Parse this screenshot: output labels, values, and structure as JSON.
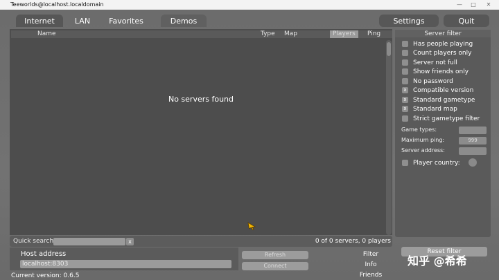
{
  "window": {
    "title": "Teeworlds@localhost.localdomain",
    "controls": [
      "—",
      "□",
      "✕"
    ]
  },
  "tabs": {
    "internet": "Internet",
    "lan": "LAN",
    "favorites": "Favorites",
    "demos": "Demos",
    "settings": "Settings",
    "quit": "Quit"
  },
  "columns": {
    "name": "Name",
    "type": "Type",
    "map": "Map",
    "players": "Players",
    "ping": "Ping"
  },
  "server_list": {
    "empty_message": "No servers found"
  },
  "quick_search": {
    "label": "Quick search:",
    "value": "",
    "clear": "x",
    "count": "0 of 0 servers, 0 players"
  },
  "filter": {
    "title": "Server filter",
    "options": [
      {
        "label": "Has people playing",
        "checked": false
      },
      {
        "label": "Count players only",
        "checked": false
      },
      {
        "label": "Server not full",
        "checked": false
      },
      {
        "label": "Show friends only",
        "checked": false
      },
      {
        "label": "No password",
        "checked": false
      },
      {
        "label": "Compatible version",
        "checked": true
      },
      {
        "label": "Standard gametype",
        "checked": true
      },
      {
        "label": "Standard map",
        "checked": true
      },
      {
        "label": "Strict gametype filter",
        "checked": false
      }
    ],
    "game_types_label": "Game types:",
    "game_types_value": "",
    "max_ping_label": "Maximum ping:",
    "max_ping_value": "999",
    "server_address_label": "Server address:",
    "server_address_value": "",
    "player_country_label": "Player country:",
    "reset_label": "Reset filter"
  },
  "host": {
    "label": "Host address",
    "value": "localhost:8303",
    "refresh": "Refresh",
    "connect": "Connect"
  },
  "side_tabs": [
    "Filter",
    "Info",
    "Friends"
  ],
  "version": "Current version: 0.6.5",
  "watermark": "知乎 @希希"
}
